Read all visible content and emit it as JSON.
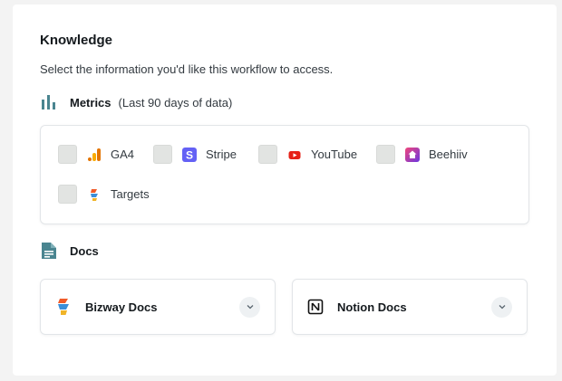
{
  "knowledge": {
    "title": "Knowledge",
    "subtitle": "Select the information you'd like this workflow to access."
  },
  "metrics": {
    "label": "Metrics",
    "note": "(Last 90 days of data)",
    "icon": "bar-chart-icon",
    "sources": [
      {
        "label": "GA4",
        "icon": "ga4-icon",
        "checked": false
      },
      {
        "label": "Stripe",
        "icon": "stripe-icon",
        "checked": false
      },
      {
        "label": "YouTube",
        "icon": "youtube-icon",
        "checked": false
      },
      {
        "label": "Beehiiv",
        "icon": "beehiiv-icon",
        "checked": false
      },
      {
        "label": "Targets",
        "icon": "bizway-icon",
        "checked": false
      }
    ]
  },
  "docs": {
    "label": "Docs",
    "icon": "document-icon",
    "items": [
      {
        "label": "Bizway Docs",
        "icon": "bizway-icon"
      },
      {
        "label": "Notion Docs",
        "icon": "notion-icon"
      }
    ]
  },
  "colors": {
    "accent": "#4a8590",
    "stripe": "#6461f5",
    "youtube": "#e62117",
    "beehiiv": "#8b3fd9",
    "ga4_light": "#f9ab00",
    "ga4_dark": "#e37400"
  }
}
